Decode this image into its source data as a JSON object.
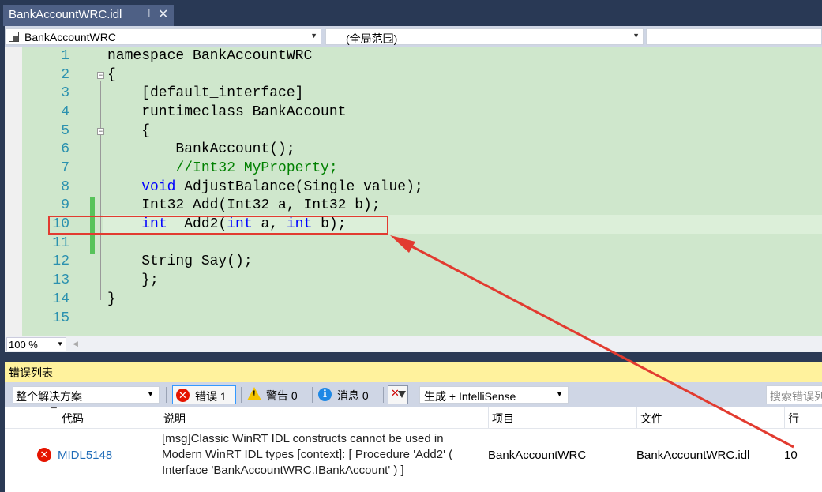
{
  "tab": {
    "title": "BankAccountWRC.idl",
    "pin": "⊣",
    "close": "✕"
  },
  "nav": {
    "project": "BankAccountWRC",
    "scope": "(全局范围)",
    "member": ""
  },
  "editor": {
    "lines": [
      {
        "n": "1"
      },
      {
        "n": "2"
      },
      {
        "n": "3"
      },
      {
        "n": "4"
      },
      {
        "n": "5"
      },
      {
        "n": "6"
      },
      {
        "n": "7"
      },
      {
        "n": "8"
      },
      {
        "n": "9"
      },
      {
        "n": "10"
      },
      {
        "n": "11"
      },
      {
        "n": "12"
      },
      {
        "n": "13"
      },
      {
        "n": "14"
      },
      {
        "n": "15"
      }
    ],
    "code": {
      "l1": "namespace BankAccountWRC",
      "l2": "{",
      "l3": "    [default_interface]",
      "l4": "    runtimeclass BankAccount",
      "l5": "    {",
      "l6": "        BankAccount();",
      "l7": "        //Int32 MyProperty;",
      "l8a": "void",
      "l8b": " AdjustBalance(Single value);",
      "l9": "    Int32 Add(Int32 a, Int32 b);",
      "l10a": "int",
      "l10b": "  Add2(",
      "l10c": "int",
      "l10d": " a, ",
      "l10e": "int",
      "l10f": " b);",
      "l12": "    String Say();",
      "l13": "    };",
      "l14": "}"
    },
    "zoom": "100 %"
  },
  "errorlist": {
    "title": "错误列表",
    "scope": "整个解决方案",
    "errors_label": "错误 1",
    "warnings_label": "警告 0",
    "messages_label": "消息 0",
    "build_filter": "生成 + IntelliSense",
    "search_placeholder": "搜索错误列",
    "columns": {
      "code": "代码",
      "desc": "说明",
      "project": "项目",
      "file": "文件",
      "line": "行"
    },
    "rows": [
      {
        "code": "MIDL5148",
        "desc": "[msg]Classic WinRT IDL constructs cannot be used in Modern WinRT IDL types [context]: [ Procedure 'Add2' ( Interface 'BankAccountWRC.IBankAccount' ) ]",
        "project": "BankAccountWRC",
        "file": "BankAccountWRC.idl",
        "line": "10"
      }
    ]
  },
  "colors": {
    "editor_bg": "#cfe7cc",
    "keyword": "#0000ff",
    "comment": "#008000",
    "line_number": "#2b91af",
    "annotation": "#e23b30"
  }
}
